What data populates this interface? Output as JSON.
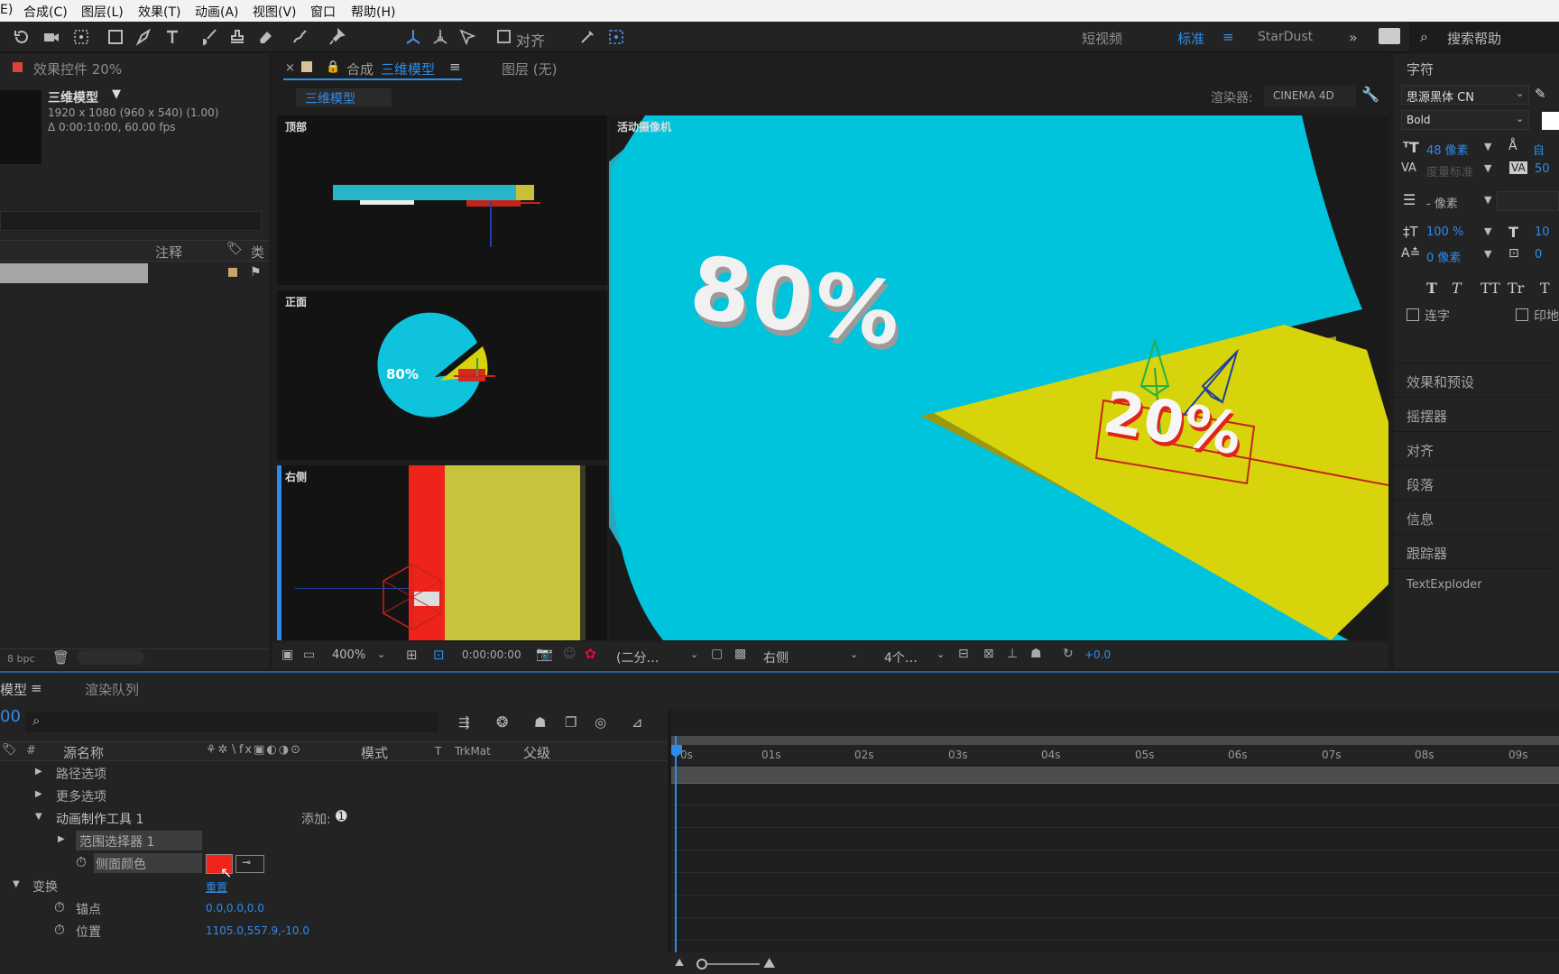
{
  "menubar": {
    "items": [
      "E)",
      "合成(C)",
      "图层(L)",
      "效果(T)",
      "动画(A)",
      "视图(V)",
      "窗口",
      "帮助(H)"
    ]
  },
  "workspaces": {
    "items": [
      "短视频",
      "标准",
      "StarDust"
    ],
    "active": "标准",
    "search_placeholder": "搜索帮助"
  },
  "toolbar": {
    "snap_label": "对齐"
  },
  "effects_panel": {
    "title": "效果控件 20%",
    "comp_name": "三维模型",
    "comp_info1": "1920 x 1080 (960 x 540) (1.00)",
    "comp_info2": "Δ 0:00:10:00, 60.00 fps",
    "col_comment": "注释",
    "col_type": "类",
    "bpc": "8 bpc"
  },
  "comp_panel": {
    "tab_label": "合成",
    "tab_comp_name": "三维模型",
    "layer_tab": "图层 (无)",
    "breadcrumb": "三维模型",
    "renderer_label": "渲染器:",
    "renderer_value": "CINEMA 4D",
    "view_top": "顶部",
    "view_front": "正面",
    "view_right": "右侧",
    "view_active": "活动摄像机",
    "front_pie_label": "80%",
    "big_label_80": "80%",
    "big_label_20": "20%",
    "zoom": "400%",
    "timecode": "0:00:00:00",
    "resolution": "(二分…",
    "view_select": "右侧",
    "view_count": "4个…",
    "exposure": "+0.0"
  },
  "char_panel": {
    "title": "字符",
    "font_family": "思源黑体 CN",
    "font_style": "Bold",
    "font_size": "48 像素",
    "leading": "自",
    "kerning": "度量标准",
    "tracking": "50",
    "stroke": "- 像素",
    "vscale": "100 %",
    "hscale": "10",
    "baseline": "0 像素",
    "tsume": "0",
    "style_buttons": [
      "T",
      "T",
      "TT",
      "Tr",
      "T"
    ],
    "ligature": "连字",
    "hindi": "印地"
  },
  "right_panels": [
    "效果和预设",
    "摇摆器",
    "对齐",
    "段落",
    "信息",
    "跟踪器",
    "TextExploder"
  ],
  "timeline": {
    "tab_label": "模型",
    "render_queue": "渲染队列",
    "timecode": "00",
    "col_num": "#",
    "col_source": "源名称",
    "col_mode": "模式",
    "col_t": "T",
    "col_trkmat": "TrkMat",
    "col_parent": "父级",
    "rows": [
      {
        "label": "路径选项",
        "arrow": "▶"
      },
      {
        "label": "更多选项",
        "arrow": "▶"
      },
      {
        "label": "动画制作工具 1",
        "arrow": "▼",
        "extra": "添加:"
      },
      {
        "label": "范围选择器 1",
        "arrow": "▶"
      },
      {
        "label": "侧面颜色",
        "arrow": ""
      },
      {
        "label": "变换",
        "arrow": "▼",
        "value": "重置"
      },
      {
        "label": "锚点",
        "arrow": "",
        "value": "0.0,0.0,0.0"
      },
      {
        "label": "位置",
        "arrow": "",
        "value": "1105.0,557.9,-10.0"
      }
    ],
    "ruler": [
      "0s",
      "01s",
      "02s",
      "03s",
      "04s",
      "05s",
      "06s",
      "07s",
      "08s",
      "09s"
    ]
  },
  "colors": {
    "cyan": "#00c3dc",
    "yellow": "#d7d40c",
    "red": "#f2231b",
    "accent": "#2d8ceb"
  }
}
